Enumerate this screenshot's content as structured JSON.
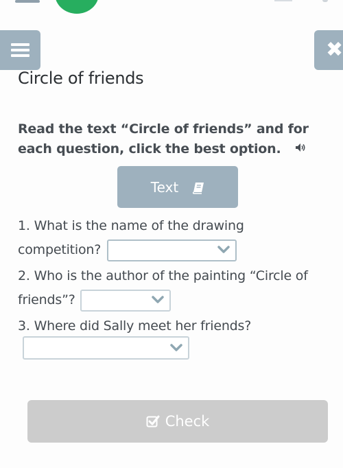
{
  "header": {
    "menu_icon": "hamburger-icon",
    "close_icon": "close-icon",
    "close_glyph": "✖"
  },
  "page": {
    "title": "Circle of friends",
    "instructions": "Read the text “Circle of friends” and for each question, click the best option.",
    "audio_icon": "speaker-icon",
    "audio_glyph": "🔊"
  },
  "text_button": {
    "label": "Text",
    "icon": "book-icon"
  },
  "questions": [
    {
      "number": "1.",
      "text": "What is the name of the drawing competition?",
      "selected": ""
    },
    {
      "number": "2.",
      "text": "Who is the author of the painting “Circle of friends”?",
      "selected": ""
    },
    {
      "number": "3.",
      "text": "Where did Sally meet her friends?",
      "selected": ""
    }
  ],
  "check_button": {
    "label": "Check",
    "icon": "checkbox-check-icon"
  },
  "colors": {
    "accent_gray_blue": "#9eb1be",
    "green": "#27ae5f",
    "disabled_button": "#cccccc"
  }
}
